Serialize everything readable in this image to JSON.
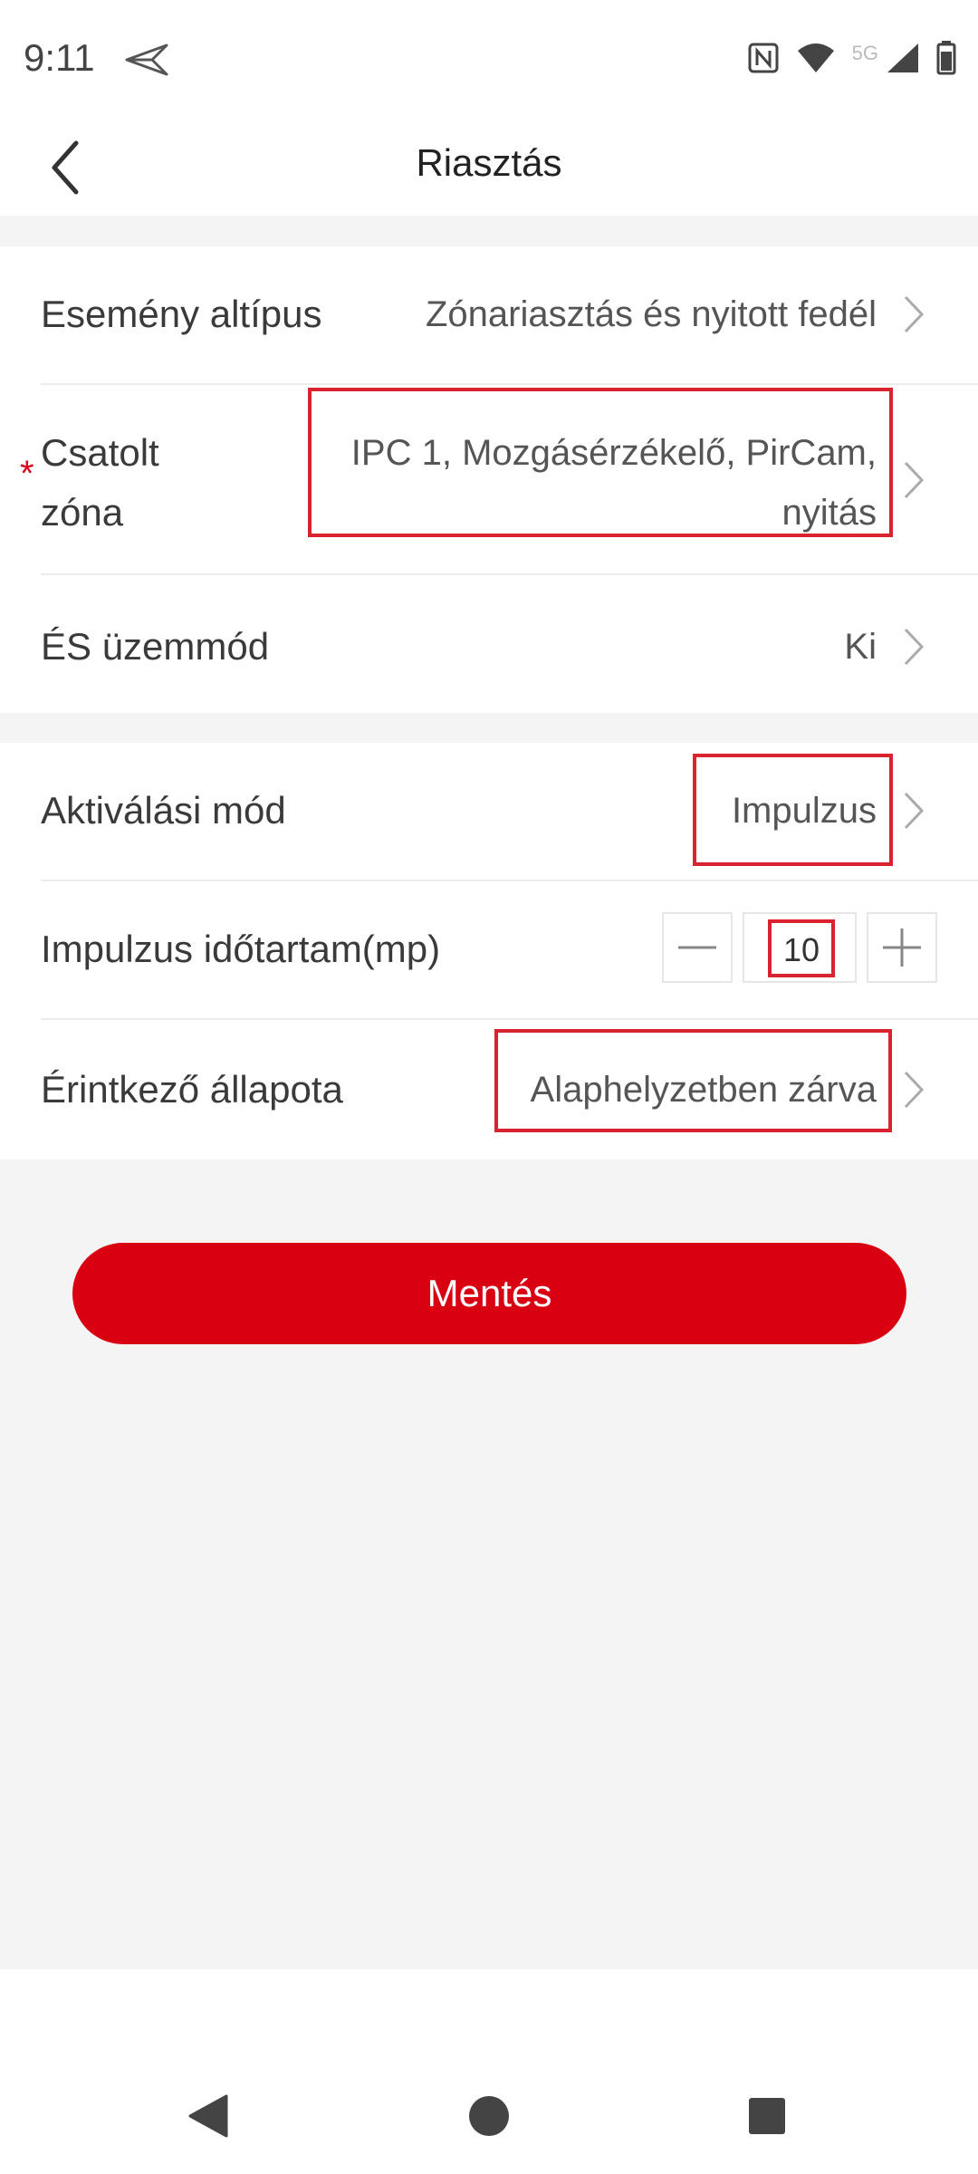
{
  "status_bar": {
    "time": "9:11",
    "network_label": "5G",
    "icons": [
      "send-icon",
      "nfc-icon",
      "wifi-icon",
      "signal-icon",
      "battery-icon"
    ]
  },
  "header": {
    "title": "Riasztás",
    "back_icon": "chevron-left-icon"
  },
  "section1": {
    "event_subtype": {
      "label": "Esemény altípus",
      "value": "Zónariasztás és nyitott fedél"
    },
    "linked_zone": {
      "label_line1": "Csatolt",
      "label_line2": "zóna",
      "required_mark": "*",
      "value_line1": "IPC 1, Mozgásérzékelő, PirCam,",
      "value_line2": "nyitás"
    },
    "and_mode": {
      "label": "ÉS üzemmód",
      "value": "Ki"
    }
  },
  "section2": {
    "activation_mode": {
      "label": "Aktiválási mód",
      "value": "Impulzus"
    },
    "pulse_duration": {
      "label": "Impulzus időtartam(mp)",
      "value": "10"
    },
    "contact_state": {
      "label": "Érintkező állapota",
      "value": "Alaphelyzetben zárva"
    }
  },
  "actions": {
    "save_label": "Mentés"
  },
  "colors": {
    "accent": "#d90011",
    "highlight": "#d9232e",
    "background": "#f4f4f4"
  }
}
